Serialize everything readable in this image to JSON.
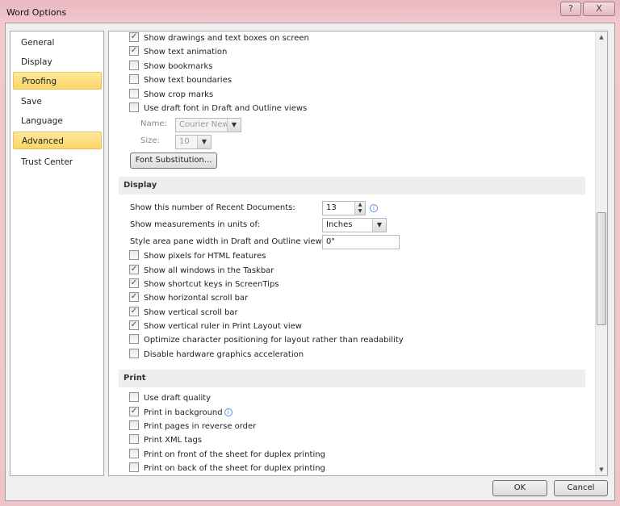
{
  "window": {
    "title": "Word Options",
    "help": "?",
    "close": "X"
  },
  "sidebar": {
    "items": [
      {
        "label": "General",
        "selected": false
      },
      {
        "label": "Display",
        "selected": false
      },
      {
        "label": "Proofing",
        "selected": true
      },
      {
        "label": "Save",
        "selected": false
      },
      {
        "label": "Language",
        "selected": false
      },
      {
        "label": "Advanced",
        "selected": true
      },
      {
        "label": "Trust Center",
        "selected": false
      }
    ]
  },
  "top_options": [
    {
      "label": "Show drawings and text boxes on screen",
      "checked": true
    },
    {
      "label": "Show text animation",
      "checked": true
    },
    {
      "label": "Show bookmarks",
      "checked": false
    },
    {
      "label": "Show text boundaries",
      "checked": false
    },
    {
      "label": "Show crop marks",
      "checked": false
    },
    {
      "label": "Use draft font in Draft and Outline views",
      "checked": false
    }
  ],
  "draft_font": {
    "name_label": "Name:",
    "name_value": "Courier New",
    "size_label": "Size:",
    "size_value": "10",
    "font_substitution": "Font Substitution..."
  },
  "display": {
    "header": "Display",
    "recent_label": "Show this number of Recent Documents:",
    "recent_value": "13",
    "units_label": "Show measurements in units of:",
    "units_value": "Inches",
    "style_label": "Style area pane width in Draft and Outline views:",
    "style_value": "0\"",
    "options": [
      {
        "label": "Show pixels for HTML features",
        "checked": false
      },
      {
        "label": "Show all windows in the Taskbar",
        "checked": true
      },
      {
        "label": "Show shortcut keys in ScreenTips",
        "checked": true
      },
      {
        "label": "Show horizontal scroll bar",
        "checked": true
      },
      {
        "label": "Show vertical scroll bar",
        "checked": true
      },
      {
        "label": "Show vertical ruler in Print Layout view",
        "checked": true
      },
      {
        "label": "Optimize character positioning for layout rather than readability",
        "checked": false
      },
      {
        "label": "Disable hardware graphics acceleration",
        "checked": false
      }
    ]
  },
  "print": {
    "header": "Print",
    "options": [
      {
        "label": "Use draft quality",
        "checked": false
      },
      {
        "label": "Print in background",
        "checked": true,
        "info": true
      },
      {
        "label": "Print pages in reverse order",
        "checked": false
      },
      {
        "label": "Print XML tags",
        "checked": false
      },
      {
        "label": "Print on front of the sheet for duplex printing",
        "checked": false
      },
      {
        "label": "Print on back of the sheet for duplex printing",
        "checked": false
      }
    ]
  },
  "footer": {
    "ok": "OK",
    "cancel": "Cancel"
  },
  "colors": {
    "selected_nav": "#fbd567",
    "check": "#2a4d8f"
  }
}
